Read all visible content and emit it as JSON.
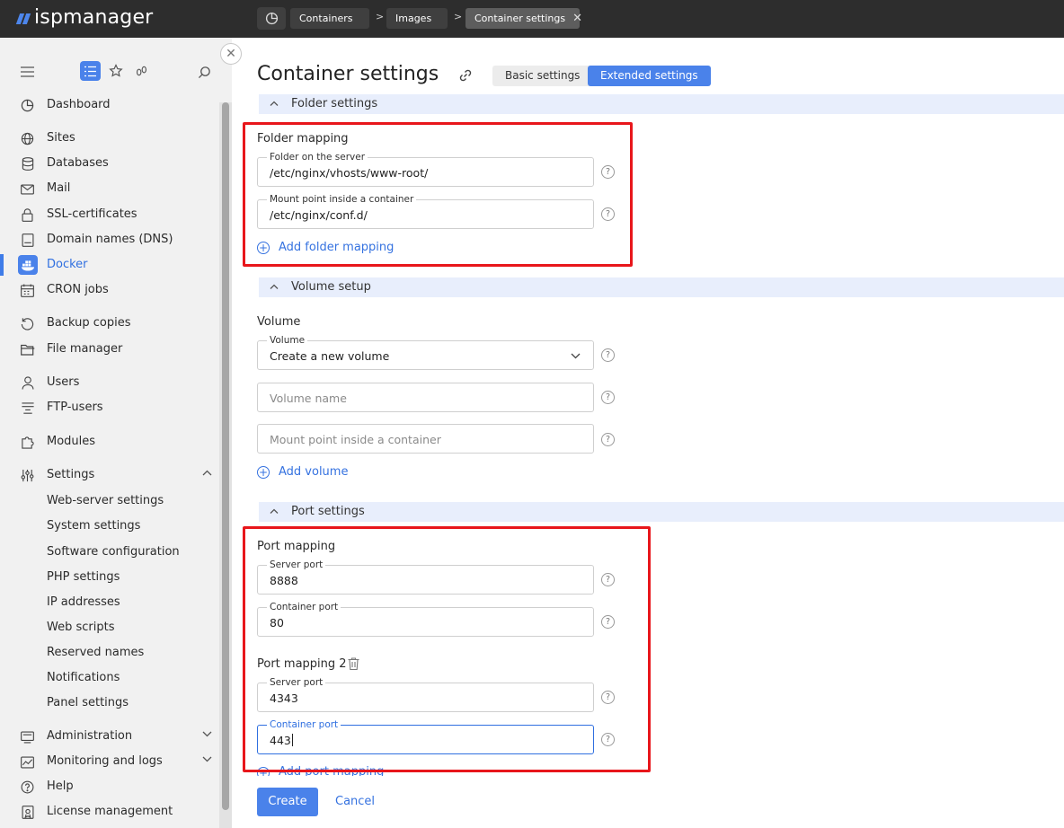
{
  "app": {
    "brand": "ispmanager",
    "accent": "#4a82ea",
    "highlight": "#e8161b"
  },
  "breadcrumbs": [
    {
      "label": "Containers"
    },
    {
      "label": "Images"
    },
    {
      "label": "Container settings"
    }
  ],
  "sidebar": {
    "items": [
      {
        "label": "Dashboard",
        "icon": "dashboard-icon"
      },
      {
        "label": "Sites",
        "icon": "globe-icon"
      },
      {
        "label": "Databases",
        "icon": "database-icon"
      },
      {
        "label": "Mail",
        "icon": "mail-icon"
      },
      {
        "label": "SSL-certificates",
        "icon": "lock-icon"
      },
      {
        "label": "Domain names (DNS)",
        "icon": "dns-icon"
      },
      {
        "label": "Docker",
        "icon": "docker-icon",
        "active": true
      },
      {
        "label": "CRON jobs",
        "icon": "calendar-icon"
      },
      {
        "label": "Backup copies",
        "icon": "backup-icon"
      },
      {
        "label": "File manager",
        "icon": "folder-icon"
      },
      {
        "label": "Users",
        "icon": "user-icon"
      },
      {
        "label": "FTP-users",
        "icon": "ftp-icon"
      },
      {
        "label": "Modules",
        "icon": "modules-icon"
      },
      {
        "label": "Settings",
        "icon": "settings-icon",
        "expanded": true
      },
      {
        "label": "Administration",
        "icon": "admin-icon"
      },
      {
        "label": "Monitoring and logs",
        "icon": "monitoring-icon"
      },
      {
        "label": "Help",
        "icon": "help-icon"
      },
      {
        "label": "License management",
        "icon": "license-icon"
      }
    ],
    "settings_sub": [
      "Web-server settings",
      "System settings",
      "Software configuration",
      "PHP settings",
      "IP addresses",
      "Web scripts",
      "Reserved names",
      "Notifications",
      "Panel settings"
    ]
  },
  "page": {
    "title": "Container settings",
    "tabs": {
      "basic": "Basic settings",
      "extended": "Extended settings"
    },
    "folder_section": {
      "title": "Folder settings",
      "group": "Folder mapping",
      "server_folder": {
        "label": "Folder on the server",
        "value": "/etc/nginx/vhosts/www-root/"
      },
      "mount_point": {
        "label": "Mount point inside a container",
        "value": "/etc/nginx/conf.d/"
      },
      "add": "Add folder mapping"
    },
    "volume_section": {
      "title": "Volume setup",
      "group": "Volume",
      "volume": {
        "label": "Volume",
        "value": "Create a new volume"
      },
      "volume_name_placeholder": "Volume name",
      "mount_placeholder": "Mount point inside a container",
      "add": "Add volume"
    },
    "port_section": {
      "title": "Port settings",
      "group1": "Port mapping",
      "server_port_1": {
        "label": "Server port",
        "value": "8888"
      },
      "container_port_1": {
        "label": "Container port",
        "value": "80"
      },
      "group2": "Port mapping 2",
      "server_port_2": {
        "label": "Server port",
        "value": "4343"
      },
      "container_port_2": {
        "label": "Container port",
        "value": "443"
      },
      "add": "Add port mapping"
    },
    "help_glyph": "?",
    "buttons": {
      "create": "Create",
      "cancel": "Cancel"
    }
  }
}
